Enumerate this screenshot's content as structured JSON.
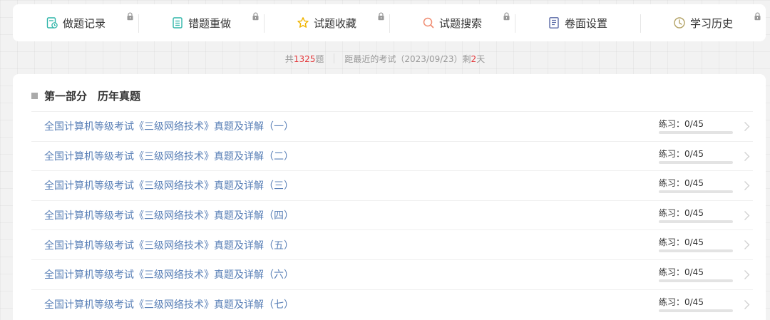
{
  "toolbar": {
    "items": [
      {
        "label": "做题记录",
        "icon": "record-icon",
        "color": "#2fb5a9"
      },
      {
        "label": "错题重做",
        "icon": "list-icon",
        "color": "#2fb5a9"
      },
      {
        "label": "试题收藏",
        "icon": "star-icon",
        "color": "#f0b400"
      },
      {
        "label": "试题搜索",
        "icon": "search-icon",
        "color": "#ef8a6f"
      },
      {
        "label": "卷面设置",
        "icon": "document-icon",
        "color": "#5a6aa6"
      },
      {
        "label": "学习历史",
        "icon": "clock-icon",
        "color": "#b2a163"
      }
    ],
    "lock_icon": "lock-icon"
  },
  "stats": {
    "total_prefix": "共",
    "total_count": "1325",
    "total_suffix": "题",
    "exam_prefix": "距最近的考试（2023/09/23）剩",
    "days_left": "2",
    "days_suffix": "天"
  },
  "section": {
    "title": "第一部分　历年真题",
    "items": [
      {
        "name": "全国计算机等级考试《三级网络技术》真题及详解（一）",
        "progress": "练习：0/45",
        "done": 0,
        "total": 45
      },
      {
        "name": "全国计算机等级考试《三级网络技术》真题及详解（二）",
        "progress": "练习：0/45",
        "done": 0,
        "total": 45
      },
      {
        "name": "全国计算机等级考试《三级网络技术》真题及详解（三）",
        "progress": "练习：0/45",
        "done": 0,
        "total": 45
      },
      {
        "name": "全国计算机等级考试《三级网络技术》真题及详解（四）",
        "progress": "练习：0/45",
        "done": 0,
        "total": 45
      },
      {
        "name": "全国计算机等级考试《三级网络技术》真题及详解（五）",
        "progress": "练习：0/45",
        "done": 0,
        "total": 45
      },
      {
        "name": "全国计算机等级考试《三级网络技术》真题及详解（六）",
        "progress": "练习：0/45",
        "done": 0,
        "total": 45
      },
      {
        "name": "全国计算机等级考试《三级网络技术》真题及详解（七）",
        "progress": "练习：0/45",
        "done": 0,
        "total": 45
      }
    ]
  },
  "colors": {
    "link": "#5a80b7",
    "highlight": "#e4393c"
  }
}
